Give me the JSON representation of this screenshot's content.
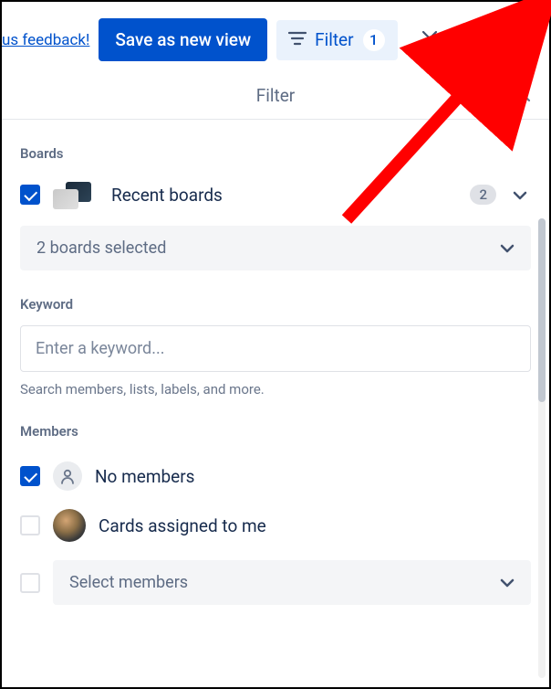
{
  "topbar": {
    "feedback_link": "us feedback!",
    "save_button": "Save as new view",
    "filter_label": "Filter",
    "filter_count": "1"
  },
  "panel": {
    "title": "Filter"
  },
  "boards": {
    "section_label": "Boards",
    "recent_label": "Recent boards",
    "recent_count": "2",
    "selected_label": "2 boards selected"
  },
  "keyword": {
    "section_label": "Keyword",
    "placeholder": "Enter a keyword...",
    "help_text": "Search members, lists, labels, and more."
  },
  "members": {
    "section_label": "Members",
    "no_members": "No members",
    "assigned_to_me": "Cards assigned to me",
    "select_members": "Select members"
  }
}
